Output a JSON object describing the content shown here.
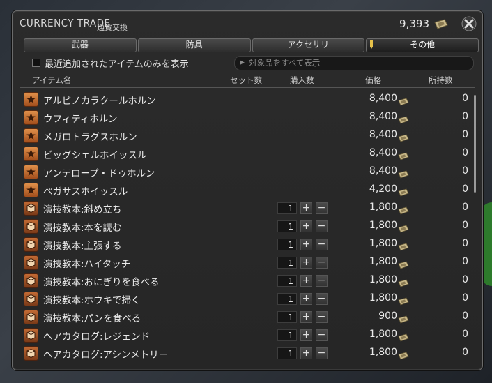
{
  "window": {
    "title_en": "CURRENCY TRADE",
    "title_jp": "通貨交換",
    "currency_amount": "9,393"
  },
  "tabs": [
    {
      "label": "武器",
      "active": false
    },
    {
      "label": "防具",
      "active": false
    },
    {
      "label": "アクセサリ",
      "active": false
    },
    {
      "label": "その他",
      "active": true
    }
  ],
  "filter": {
    "checkbox_label": "最近追加されたアイテムのみを表示",
    "checked": false,
    "search_placeholder": "対象品をすべて表示"
  },
  "columns": {
    "item_name": "アイテム名",
    "set_count": "セット数",
    "purchase_qty": "購入数",
    "price": "価格",
    "owned": "所持数"
  },
  "items": [
    {
      "icon": "star",
      "name": "アルビノカラクールホルン",
      "qty": "",
      "price": "8,400",
      "owned": "0"
    },
    {
      "icon": "star",
      "name": "ウフィティホルン",
      "qty": "",
      "price": "8,400",
      "owned": "0"
    },
    {
      "icon": "star",
      "name": "メガロトラグスホルン",
      "qty": "",
      "price": "8,400",
      "owned": "0"
    },
    {
      "icon": "star",
      "name": "ビッグシェルホイッスル",
      "qty": "",
      "price": "8,400",
      "owned": "0"
    },
    {
      "icon": "star",
      "name": "アンテロープ・ドゥホルン",
      "qty": "",
      "price": "8,400",
      "owned": "0"
    },
    {
      "icon": "star",
      "name": "ペガサスホイッスル",
      "qty": "",
      "price": "4,200",
      "owned": "0"
    },
    {
      "icon": "box",
      "name": "演技教本:斜め立ち",
      "qty": "1",
      "price": "1,800",
      "owned": "0"
    },
    {
      "icon": "box",
      "name": "演技教本:本を読む",
      "qty": "1",
      "price": "1,800",
      "owned": "0"
    },
    {
      "icon": "box",
      "name": "演技教本:主張する",
      "qty": "1",
      "price": "1,800",
      "owned": "0"
    },
    {
      "icon": "box",
      "name": "演技教本:ハイタッチ",
      "qty": "1",
      "price": "1,800",
      "owned": "0"
    },
    {
      "icon": "box",
      "name": "演技教本:おにぎりを食べる",
      "qty": "1",
      "price": "1,800",
      "owned": "0"
    },
    {
      "icon": "box",
      "name": "演技教本:ホウキで掃く",
      "qty": "1",
      "price": "1,800",
      "owned": "0"
    },
    {
      "icon": "box",
      "name": "演技教本:パンを食べる",
      "qty": "1",
      "price": "900",
      "owned": "0"
    },
    {
      "icon": "box",
      "name": "ヘアカタログ:レジェンド",
      "qty": "1",
      "price": "1,800",
      "owned": "0"
    },
    {
      "icon": "box",
      "name": "ヘアカタログ:アシンメトリー",
      "qty": "1",
      "price": "1,800",
      "owned": "0"
    }
  ],
  "colors": {
    "window_bg": "#2b2b2b",
    "icon_orange": "#c26a34",
    "text": "#eaeaea"
  }
}
